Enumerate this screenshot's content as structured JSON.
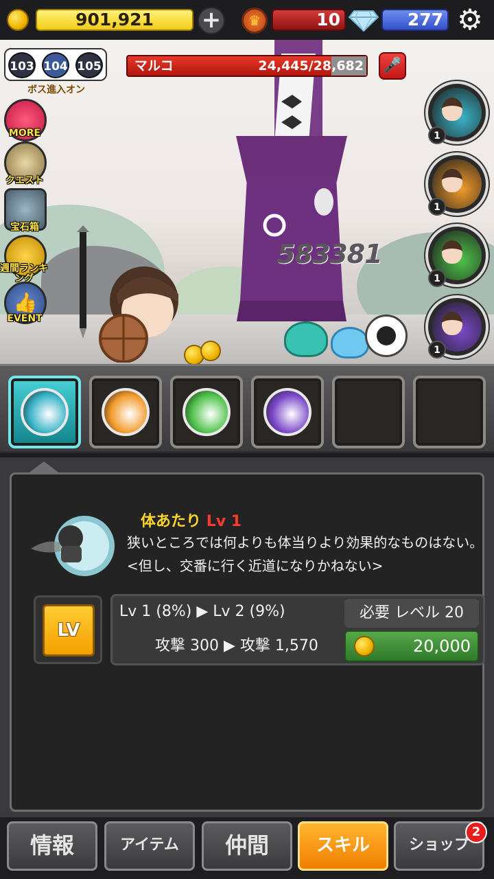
{
  "topbar": {
    "gold": "901,921",
    "plus_icon": "plus-icon",
    "crown_icon": "crown-icon",
    "crowns": "10",
    "gem_icon": "diamond-icon",
    "gems": "277",
    "settings_icon": "gear-icon"
  },
  "stage": {
    "prev": "103",
    "current": "104",
    "next": "105",
    "boss_toggle_label": "ボス進入オン"
  },
  "boss": {
    "name": "マルコ",
    "hp": "24,445/28,682",
    "hp_fraction": 0.852,
    "damage_popup": "583381"
  },
  "side_menu": [
    {
      "label": "MORE",
      "icon": "more-icon"
    },
    {
      "label": "クエスト",
      "icon": "quest-scroll-icon"
    },
    {
      "label": "宝石箱",
      "icon": "treasure-chest-icon"
    },
    {
      "label": "週間ランキング",
      "icon": "trophy-icon"
    },
    {
      "label": "EVENT",
      "icon": "thumbs-up-icon"
    }
  ],
  "heroes": [
    {
      "level": "1",
      "color": "#3ab4c8"
    },
    {
      "level": "1",
      "color": "#f29a2a"
    },
    {
      "level": "1",
      "color": "#4ec24a"
    },
    {
      "level": "1",
      "color": "#7a48c8"
    }
  ],
  "skill_slots": [
    {
      "state": "selected",
      "color": "#3ab4c8"
    },
    {
      "state": "filled",
      "color": "#f29a2a"
    },
    {
      "state": "filled",
      "color": "#4ec24a"
    },
    {
      "state": "filled",
      "color": "#7a48c8"
    },
    {
      "state": "empty"
    },
    {
      "state": "empty"
    }
  ],
  "skill": {
    "name": "体あたり",
    "level": "Lv 1",
    "description": "狭いところでは何よりも体当りより効果的なものはない。<但し、交番に行く近道になりかねない>",
    "lv_button": "LV",
    "level_change": "Lv 1 (8%) ▶ Lv 2 (9%)",
    "attack_change": "攻撃 300 ▶ 攻撃 1,570",
    "required_level": "必要 レベル 20",
    "cost": "20,000"
  },
  "tabs": [
    {
      "label": "情報",
      "active": false
    },
    {
      "label": "アイテム",
      "active": false
    },
    {
      "label": "仲間",
      "active": false
    },
    {
      "label": "スキル",
      "active": true
    },
    {
      "label": "ショップ",
      "active": false
    }
  ],
  "shop_badge": "2"
}
